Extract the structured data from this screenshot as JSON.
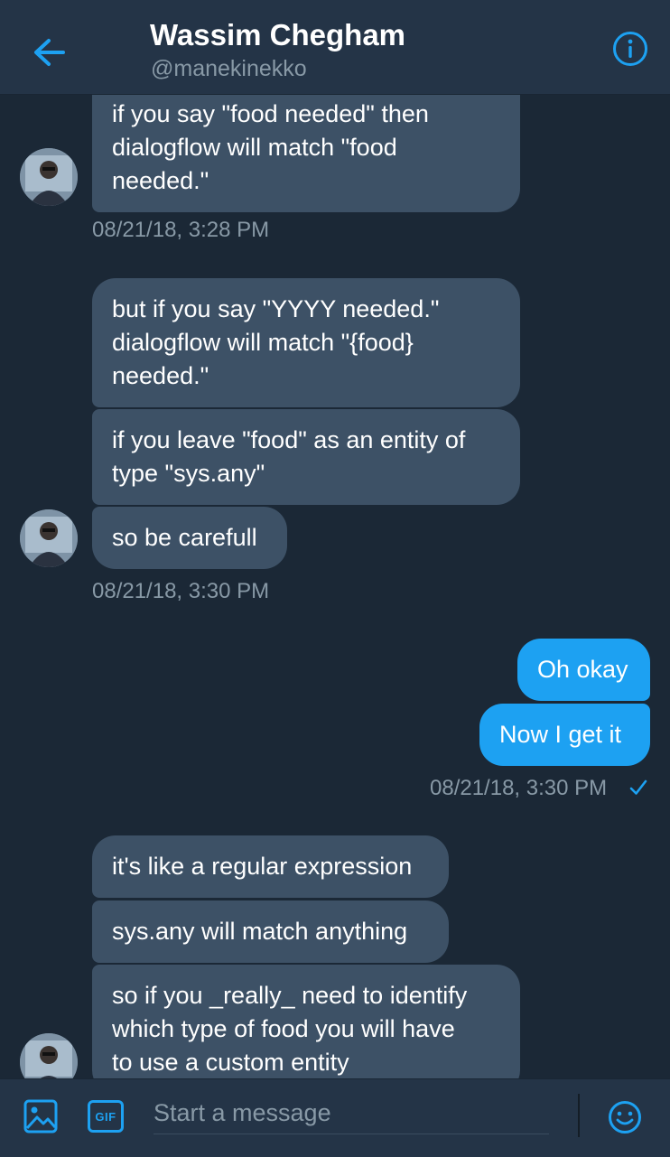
{
  "header": {
    "title": "Wassim Chegham",
    "handle": "@manekinekko"
  },
  "messages": {
    "m1": "if you say \"food needed\" then\ndialogflow will match \"food\nneeded.\"",
    "t1": "08/21/18, 3:28 PM",
    "m2": "but if you say \"YYYY needed.\"\ndialogflow will match \"{food}\nneeded.\"",
    "m3": "if you leave \"food\" as an entity of\ntype \"sys.any\"",
    "m4": "so be carefull",
    "t2": "08/21/18, 3:30 PM",
    "m5": "Oh okay",
    "m6": "Now I get it",
    "t3": "08/21/18, 3:30 PM",
    "m7": "it's like a regular expression",
    "m8": "sys.any will match anything",
    "m9": "so if you _really_ need to identify\nwhich type of food you will have\nto use a custom entity"
  },
  "composer": {
    "placeholder": "Start a message",
    "gif_label": "GIF"
  },
  "colors": {
    "background": "#1b2836",
    "header": "#243447",
    "incoming_bubble": "#3d5166",
    "outgoing_bubble": "#1da1f2",
    "accent": "#1da1f2",
    "muted_text": "#8899a6"
  },
  "icons": {
    "back": "back-arrow-icon",
    "info": "info-icon",
    "image": "image-icon",
    "gif": "gif-icon",
    "emoji": "emoji-icon",
    "read_receipt": "checkmark-icon"
  }
}
